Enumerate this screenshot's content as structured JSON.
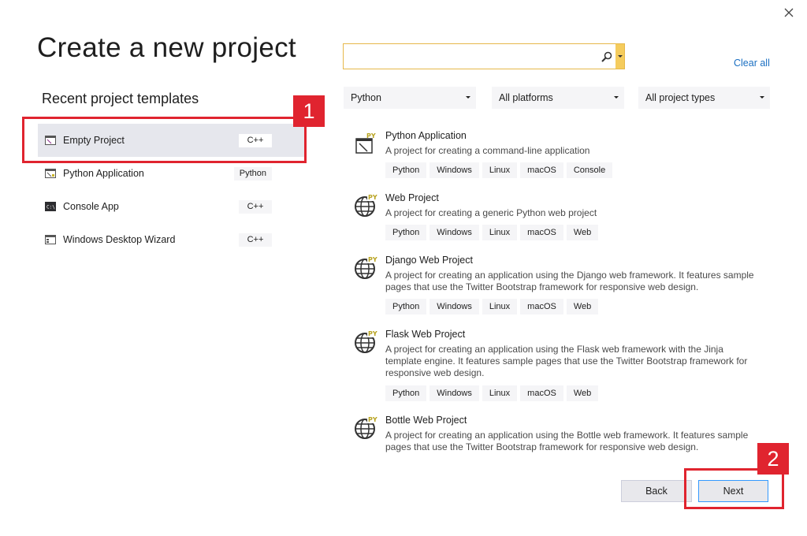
{
  "window": {
    "close_icon": "close-icon"
  },
  "title": "Create a new project",
  "recent": {
    "heading": "Recent project templates",
    "items": [
      {
        "label": "Empty Project",
        "lang": "C++",
        "icon": "empty-project-icon"
      },
      {
        "label": "Python Application",
        "lang": "Python",
        "icon": "python-application-icon"
      },
      {
        "label": "Console App",
        "lang": "C++",
        "icon": "console-app-icon"
      },
      {
        "label": "Windows Desktop Wizard",
        "lang": "C++",
        "icon": "windows-desktop-wizard-icon"
      }
    ]
  },
  "search": {
    "placeholder": "",
    "value": "",
    "icon": "search-icon"
  },
  "clear_all": "Clear all",
  "filters": {
    "language": "Python",
    "platform": "All platforms",
    "project_type": "All project types"
  },
  "templates": [
    {
      "name": "Python Application",
      "description": "A project for creating a command-line application",
      "tags": [
        "Python",
        "Windows",
        "Linux",
        "macOS",
        "Console"
      ],
      "icon": "python-application-icon"
    },
    {
      "name": "Web Project",
      "description": "A project for creating a generic Python web project",
      "tags": [
        "Python",
        "Windows",
        "Linux",
        "macOS",
        "Web"
      ],
      "icon": "python-web-globe-icon"
    },
    {
      "name": "Django Web Project",
      "description": "A project for creating an application using the Django web framework. It features sample pages that use the Twitter Bootstrap framework for responsive web design.",
      "tags": [
        "Python",
        "Windows",
        "Linux",
        "macOS",
        "Web"
      ],
      "icon": "python-web-globe-icon"
    },
    {
      "name": "Flask Web Project",
      "description": "A project for creating an application using the Flask web framework with the Jinja template engine. It features sample pages that use the Twitter Bootstrap framework for responsive web design.",
      "tags": [
        "Python",
        "Windows",
        "Linux",
        "macOS",
        "Web"
      ],
      "icon": "python-web-globe-icon"
    },
    {
      "name": "Bottle Web Project",
      "description": "A project for creating an application using the Bottle web framework. It features sample pages that use the Twitter Bootstrap framework for responsive web design.",
      "tags": [],
      "icon": "python-web-globe-icon"
    }
  ],
  "buttons": {
    "back": "Back",
    "next": "Next"
  },
  "annotations": {
    "step1": "1",
    "step2": "2",
    "highlight_color": "#e0242f"
  },
  "colors": {
    "accent": "#3399ff",
    "link": "#1a6fc2",
    "search_border": "#e6b84a",
    "selected_bg": "#e6e7ed"
  }
}
